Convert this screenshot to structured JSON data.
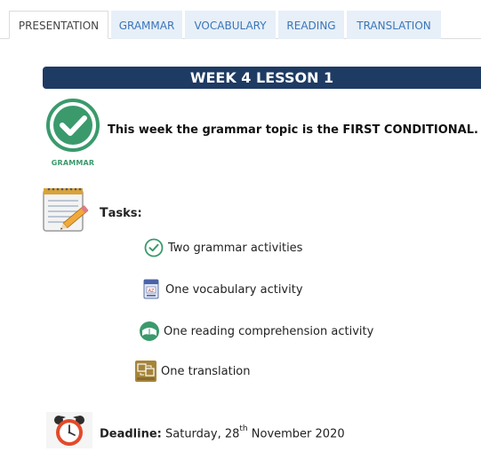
{
  "tabs": [
    {
      "label": "PRESENTATION",
      "active": true
    },
    {
      "label": "GRAMMAR",
      "active": false
    },
    {
      "label": "VOCABULARY",
      "active": false
    },
    {
      "label": "READING",
      "active": false
    },
    {
      "label": "TRANSLATION",
      "active": false
    }
  ],
  "banner": {
    "title": "WEEK 4 LESSON 1"
  },
  "grammar": {
    "icon_caption": "GRAMMAR",
    "topic_text": "This week the grammar topic is the FIRST CONDITIONAL."
  },
  "tasks": {
    "label_initial": "T",
    "label_rest": "asks:",
    "items": [
      {
        "text": "Two grammar activities",
        "icon": "check-circle-icon"
      },
      {
        "text": "One vocabulary activity",
        "icon": "vocabulary-book-icon"
      },
      {
        "text": "One reading comprehension activity",
        "icon": "reading-globe-icon"
      },
      {
        "text": "One translation",
        "icon": "translation-icon"
      }
    ]
  },
  "deadline": {
    "label": "Deadline:",
    "date_prefix": " Saturday, 28",
    "date_suffix": "th",
    "date_rest": " November 2020",
    "icon": "alarm-clock-icon"
  },
  "colors": {
    "banner_bg": "#1e3b63",
    "grammar_green": "#3a9a6c",
    "tab_bg": "#e7eff8",
    "tab_text": "#3a76b8"
  }
}
